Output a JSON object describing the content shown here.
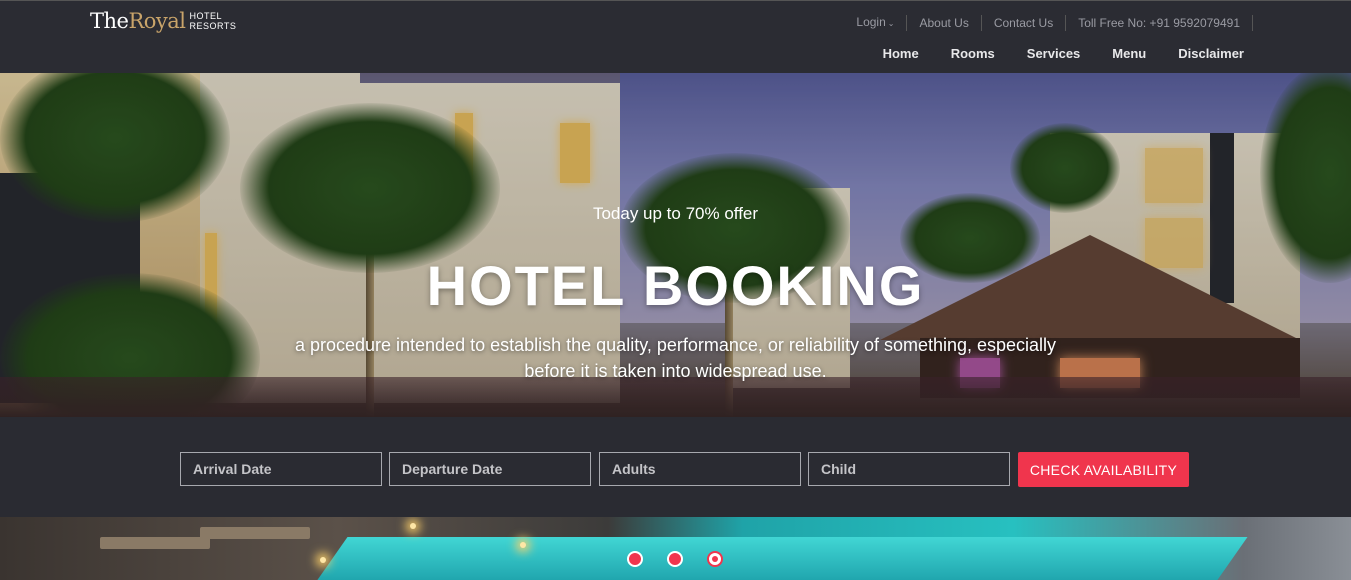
{
  "header": {
    "logo": {
      "the": "The",
      "royal": "Royal",
      "hotel": "HOTEL",
      "resorts": "RESORTS"
    },
    "top_links": [
      {
        "label": "Login",
        "has_caret": true
      },
      {
        "label": "About Us"
      },
      {
        "label": "Contact Us"
      },
      {
        "label": "Toll Free No: +91 9592079491"
      }
    ],
    "nav": [
      "Home",
      "Rooms",
      "Services",
      "Menu",
      "Disclaimer"
    ]
  },
  "hero": {
    "offer": "Today up to 70% offer",
    "title": "HOTEL BOOKING",
    "description": "a procedure intended to establish the quality, performance, or reliability of something, especially before it is taken into widespread use."
  },
  "booking": {
    "arrival_placeholder": "Arrival Date",
    "departure_placeholder": "Departure Date",
    "adults_placeholder": "Adults",
    "child_placeholder": "Child",
    "check_label": "CHECK AVAILABILITY"
  },
  "slider": {
    "count": 3,
    "active": 3
  },
  "colors": {
    "accent": "#f0354d",
    "header_bg": "#2b2c33",
    "logo_gold": "#c9a46a"
  }
}
